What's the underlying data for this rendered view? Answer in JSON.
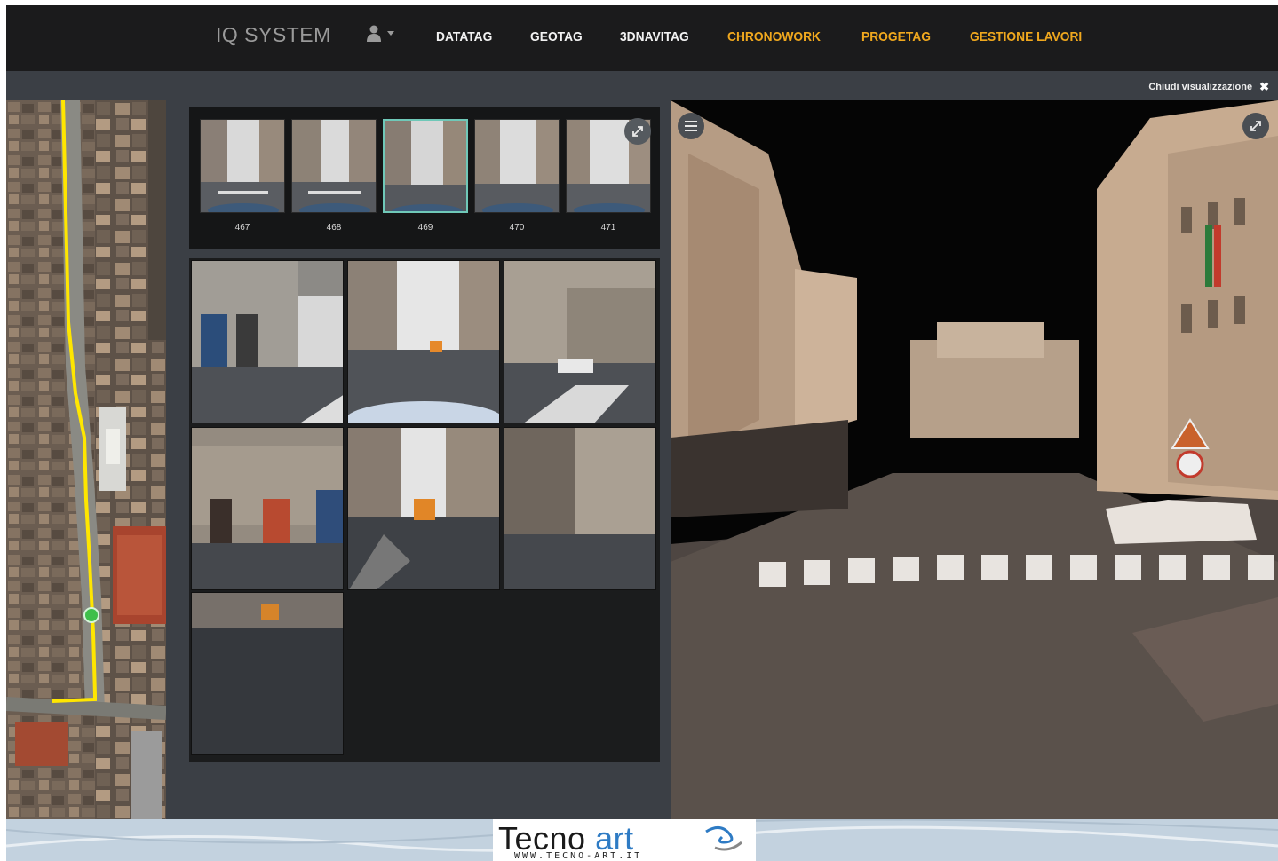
{
  "navbar": {
    "brand": "IQ SYSTEM",
    "items": [
      {
        "label": "DATATAG",
        "accent": false
      },
      {
        "label": "GEOTAG",
        "accent": false
      },
      {
        "label": "3DNAVITAG",
        "accent": false
      },
      {
        "label": "CHRONOWORK",
        "accent": true
      },
      {
        "label": "PROGETAG",
        "accent": true
      },
      {
        "label": "GESTIONE LAVORI",
        "accent": true
      }
    ],
    "user_icon": "user-icon",
    "caret_icon": "caret-down-icon"
  },
  "subbar": {
    "close_label": "Chiudi visualizzazione",
    "close_icon": "close-icon"
  },
  "filmstrip": {
    "frames": [
      "467",
      "468",
      "469",
      "470",
      "471"
    ],
    "selected": "469",
    "expand_icon": "expand-icon"
  },
  "viewer": {
    "menu_icon": "hamburger-menu-icon",
    "expand_icon": "expand-icon"
  },
  "footer": {
    "logo_word1": "Tecno",
    "logo_word2": "art",
    "logo_url": "WWW.TECNO-ART.IT"
  },
  "colors": {
    "navbar_bg": "#1b1b1c",
    "accent": "#f0a81e",
    "route": "#ffe600",
    "position_marker": "#3fbf4a",
    "selected_border": "#6fc8b8"
  }
}
